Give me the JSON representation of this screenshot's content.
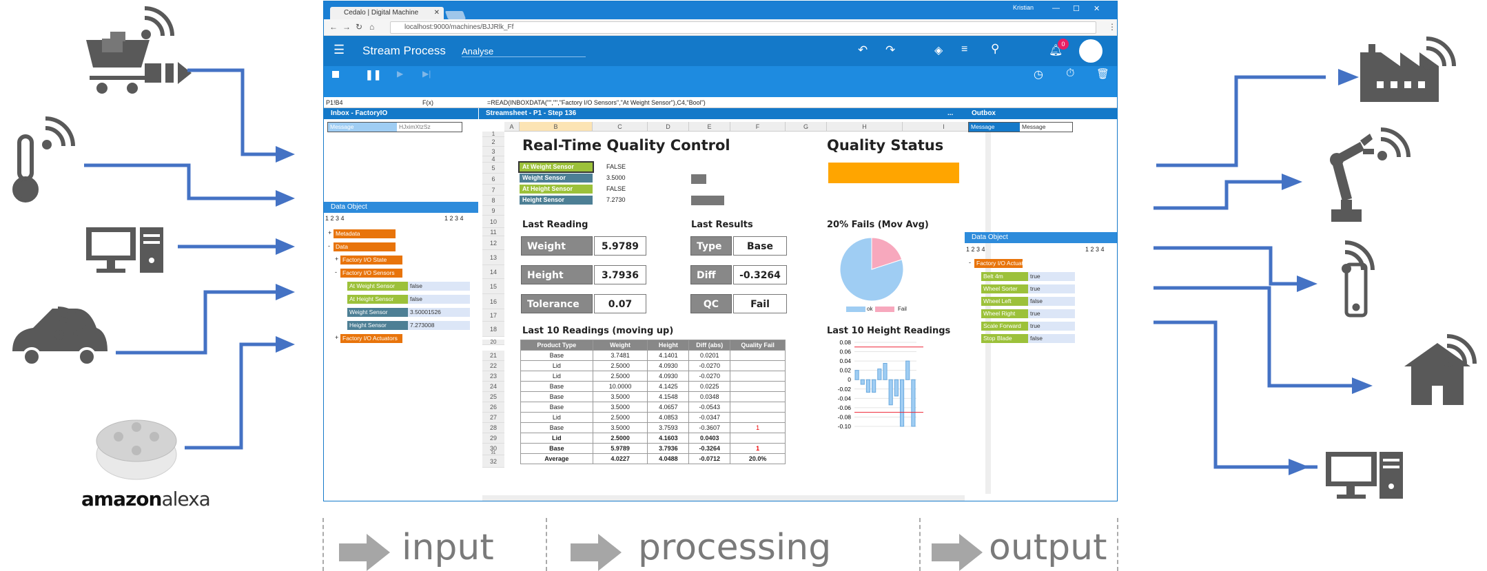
{
  "browser": {
    "tab_title": "Cedalo | Digital Machine",
    "user": "Kristian",
    "url": "localhost:9000/machines/BJJRlk_Ff"
  },
  "app": {
    "title": "Stream Process",
    "subtitle": "Analyse",
    "notifications": "0"
  },
  "formula": {
    "cell": "P1!B4",
    "fx": "F(x)",
    "expression": "=READ(INBOXDATA(\"\",\"\",\"Factory I/O Sensors\",\"At Weight Sensor\"),C4,\"Bool\")"
  },
  "inbox": {
    "title": "Inbox - FactoryIO",
    "msg_label": "Message",
    "msg_id": "HJximXtzSz"
  },
  "data_object_left": {
    "title": "Data Object",
    "levels": "1 2 3 4",
    "levels_right": "1 2 3 4",
    "nodes": [
      {
        "sign": "+",
        "label": "Metadata"
      },
      {
        "sign": "-",
        "label": "Data"
      },
      {
        "sign": "+",
        "label": "Factory I/O State"
      },
      {
        "sign": "-",
        "label": "Factory I/O Sensors"
      },
      {
        "sign": "+",
        "label": "Factory I/O Actuators"
      }
    ],
    "sensors": [
      {
        "label": "At Weight Sensor",
        "value": "false"
      },
      {
        "label": "At Height Sensor",
        "value": "false"
      },
      {
        "label": "Weight Sensor",
        "value": "3.50001526"
      },
      {
        "label": "Height Sensor",
        "value": "7.273008"
      }
    ]
  },
  "sheet": {
    "title": "Streamsheet - P1 - Step 136",
    "columns": [
      "A",
      "B",
      "C",
      "D",
      "E",
      "F",
      "G",
      "H",
      "I"
    ],
    "rows": [
      "1",
      "2",
      "3",
      "4",
      "5",
      "6",
      "7",
      "8",
      "9",
      "10",
      "11",
      "12",
      "13",
      "14",
      "15",
      "16",
      "17",
      "18",
      "19",
      "20",
      "21",
      "22",
      "23",
      "24",
      "25",
      "26",
      "27",
      "28",
      "29",
      "30",
      "31",
      "32"
    ],
    "heading_rt": "Real-Time Quality Control",
    "heading_qs": "Quality Status",
    "sensors": [
      {
        "label": "At Weight Sensor",
        "value": "FALSE"
      },
      {
        "label": "Weight Sensor",
        "value": "3.5000"
      },
      {
        "label": "At Height Sensor",
        "value": "FALSE"
      },
      {
        "label": "Height Sensor",
        "value": "7.2730"
      }
    ],
    "last_reading": "Last Reading",
    "last_results": "Last Results",
    "fails_title": "20% Fails (Mov Avg)",
    "weight_label": "Weight",
    "weight_value": "5.9789",
    "height_label": "Height",
    "height_value": "3.7936",
    "tolerance_label": "Tolerance",
    "tolerance_value": "0.07",
    "type_label": "Type",
    "type_value": "Base",
    "diff_label": "Diff",
    "diff_value": "-0.3264",
    "qc_label": "QC",
    "qc_value": "Fail",
    "legend_ok": "ok",
    "legend_fail": "Fail",
    "last10_title": "Last 10 Readings (moving up)",
    "last10h_title": "Last 10 Height Readings",
    "table_headers": [
      "Product Type",
      "Weight",
      "Height",
      "Diff (abs)",
      "Quality Fail"
    ],
    "table_rows": [
      [
        "Base",
        "3.7481",
        "4.1401",
        "0.0201",
        ""
      ],
      [
        "Lid",
        "2.5000",
        "4.0930",
        "-0.0270",
        ""
      ],
      [
        "Lid",
        "2.5000",
        "4.0930",
        "-0.0270",
        ""
      ],
      [
        "Base",
        "10.0000",
        "4.1425",
        "0.0225",
        ""
      ],
      [
        "Base",
        "3.5000",
        "4.1548",
        "0.0348",
        ""
      ],
      [
        "Base",
        "3.5000",
        "4.0657",
        "-0.0543",
        ""
      ],
      [
        "Lid",
        "2.5000",
        "4.0853",
        "-0.0347",
        ""
      ],
      [
        "Base",
        "3.5000",
        "3.7593",
        "-0.3607",
        "1"
      ],
      [
        "Lid",
        "2.5000",
        "4.1603",
        "0.0403",
        ""
      ],
      [
        "Base",
        "5.9789",
        "3.7936",
        "-0.3264",
        "1"
      ]
    ],
    "table_row_nums": [
      "21",
      "22",
      "23",
      "24",
      "25",
      "26",
      "27",
      "28",
      "29",
      "30"
    ],
    "avg": [
      "Average",
      "4.0227",
      "4.0488",
      "-0.0712",
      "20.0%"
    ]
  },
  "outbox": {
    "title": "Outbox",
    "msg_label": "Message",
    "msg_value": "Message"
  },
  "data_object_right": {
    "title": "Data Object",
    "levels": "1 2 3 4",
    "levels_right": "1 2 3 4",
    "root": "Factory I/O Actuators",
    "items": [
      {
        "label": "Belt 4m",
        "value": "true"
      },
      {
        "label": "Wheel Sorter",
        "value": "true"
      },
      {
        "label": "Wheel Left",
        "value": "false"
      },
      {
        "label": "Wheel Right",
        "value": "true"
      },
      {
        "label": "Scale Forward",
        "value": "true"
      },
      {
        "label": "Stop Blade",
        "value": "false"
      }
    ]
  },
  "alexa": {
    "brand": "amazon",
    "product": "alexa"
  },
  "labels": {
    "input": "input",
    "processing": "processing",
    "output": "output"
  },
  "chart_data": [
    {
      "type": "pie",
      "title": "20% Fails (Mov Avg)",
      "categories": [
        "ok",
        "Fail"
      ],
      "values": [
        80,
        20
      ],
      "colors": [
        "#9fcdf3",
        "#f7a8bd"
      ]
    },
    {
      "type": "bar",
      "title": "Last 10 Height Readings",
      "ylim": [
        -0.1,
        0.08
      ],
      "yticks": [
        "0.08",
        "0.06",
        "0.04",
        "0.02",
        "0",
        "-0.02",
        "-0.04",
        "-0.06",
        "-0.08",
        "-0.10"
      ],
      "values": [
        0.02,
        -0.01,
        -0.027,
        -0.027,
        0.023,
        0.035,
        -0.054,
        -0.035,
        -0.361,
        0.04,
        -0.326
      ],
      "limits": [
        0.07,
        -0.07
      ]
    }
  ]
}
